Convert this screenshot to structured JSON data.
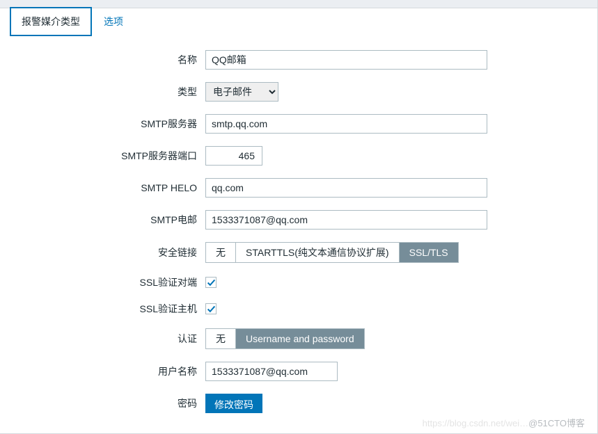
{
  "tabs": {
    "media_type": "报警媒介类型",
    "options": "选项"
  },
  "labels": {
    "name": "名称",
    "type": "类型",
    "smtp_server": "SMTP服务器",
    "smtp_port": "SMTP服务器端口",
    "smtp_helo": "SMTP HELO",
    "smtp_email": "SMTP电邮",
    "conn_security": "安全链接",
    "ssl_verify_peer": "SSL验证对端",
    "ssl_verify_host": "SSL验证主机",
    "auth": "认证",
    "username": "用户名称",
    "password": "密码"
  },
  "values": {
    "name": "QQ邮箱",
    "type": "电子邮件",
    "smtp_server": "smtp.qq.com",
    "smtp_port": "465",
    "smtp_helo": "qq.com",
    "smtp_email": "1533371087@qq.com",
    "username": "1533371087@qq.com"
  },
  "segments": {
    "security_none": "无",
    "security_starttls": "STARTTLS(纯文本通信协议扩展)",
    "security_ssltls": "SSL/TLS",
    "auth_none": "无",
    "auth_userpass": "Username and password"
  },
  "buttons": {
    "change_password": "修改密码"
  },
  "watermark": {
    "faint": "https://blog.csdn.net/wei…",
    "text": "@51CTO博客"
  }
}
